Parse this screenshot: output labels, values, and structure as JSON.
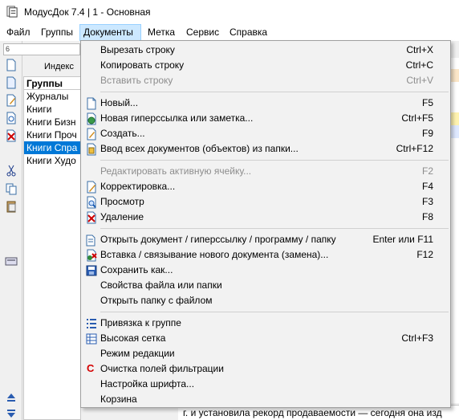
{
  "window": {
    "title": "МодусДок 7.4 | 1 - Основная"
  },
  "menubar": {
    "items": [
      {
        "label": "Файл"
      },
      {
        "label": "Группы"
      },
      {
        "label": "Документы"
      },
      {
        "label": "Метка"
      },
      {
        "label": "Сервис"
      },
      {
        "label": "Справка"
      }
    ]
  },
  "background": {
    "combo_value": "6",
    "index_tab_label": "Индекс",
    "groups_header": "Группы",
    "groups": [
      {
        "label": "Журналы"
      },
      {
        "label": "Книги"
      },
      {
        "label": "Книги Бизн"
      },
      {
        "label": "Книги Проч"
      },
      {
        "label": "Книги Спра"
      },
      {
        "label": "Книги Худо"
      }
    ],
    "selected_group": "Книги Спра",
    "status_text": "г. и установила рекорд продаваемости — сегодня она изд"
  },
  "dropdown": {
    "items": [
      {
        "label": "Вырезать строку",
        "shortcut": "Ctrl+X",
        "icon": "none",
        "disabled": false
      },
      {
        "label": "Копировать строку",
        "shortcut": "Ctrl+C",
        "icon": "none",
        "disabled": false
      },
      {
        "label": "Вставить строку",
        "shortcut": "Ctrl+V",
        "icon": "none",
        "disabled": true
      },
      {
        "label": "Новый...",
        "shortcut": "F5",
        "icon": "new-document-icon",
        "disabled": false
      },
      {
        "label": "Новая гиперссылка или заметка...",
        "shortcut": "Ctrl+F5",
        "icon": "globe-document-icon",
        "disabled": false
      },
      {
        "label": "Создать...",
        "shortcut": "F9",
        "icon": "create-document-icon",
        "disabled": false
      },
      {
        "label": "Ввод всех документов (объектов) из папки...",
        "shortcut": "Ctrl+F12",
        "icon": "folder-import-icon",
        "disabled": false
      },
      {
        "label": "Редактировать активную ячейку...",
        "shortcut": "F2",
        "icon": "none",
        "disabled": true
      },
      {
        "label": "Корректировка...",
        "shortcut": "F4",
        "icon": "edit-document-icon",
        "disabled": false
      },
      {
        "label": "Просмотр",
        "shortcut": "F3",
        "icon": "view-magnifier-icon",
        "disabled": false
      },
      {
        "label": "Удаление",
        "shortcut": "F8",
        "icon": "delete-document-icon",
        "disabled": false
      },
      {
        "label": "Открыть документ / гиперссылку / программу / папку",
        "shortcut": "Enter или F11",
        "icon": "open-document-icon",
        "disabled": false
      },
      {
        "label": "Вставка / связывание нового документа (замена)...",
        "shortcut": "F12",
        "icon": "insert-link-icon",
        "disabled": false
      },
      {
        "label": "Сохранить как...",
        "shortcut": "",
        "icon": "save-icon",
        "disabled": false
      },
      {
        "label": "Свойства файла или папки",
        "shortcut": "",
        "icon": "none",
        "disabled": false
      },
      {
        "label": "Открыть папку с файлом",
        "shortcut": "",
        "icon": "none",
        "disabled": false
      },
      {
        "label": "Привязка к группе",
        "shortcut": "",
        "icon": "group-binding-icon",
        "disabled": false
      },
      {
        "label": "Высокая сетка",
        "shortcut": "Ctrl+F3",
        "icon": "tall-grid-icon",
        "disabled": false
      },
      {
        "label": "Режим редакции",
        "shortcut": "",
        "icon": "none",
        "disabled": false
      },
      {
        "label": "Очистка полей фильтрации",
        "shortcut": "",
        "icon": "clear-filter-icon",
        "disabled": false
      },
      {
        "label": "Настройка шрифта...",
        "shortcut": "",
        "icon": "none",
        "disabled": false
      },
      {
        "label": "Корзина",
        "shortcut": "",
        "icon": "none",
        "disabled": false
      }
    ]
  }
}
